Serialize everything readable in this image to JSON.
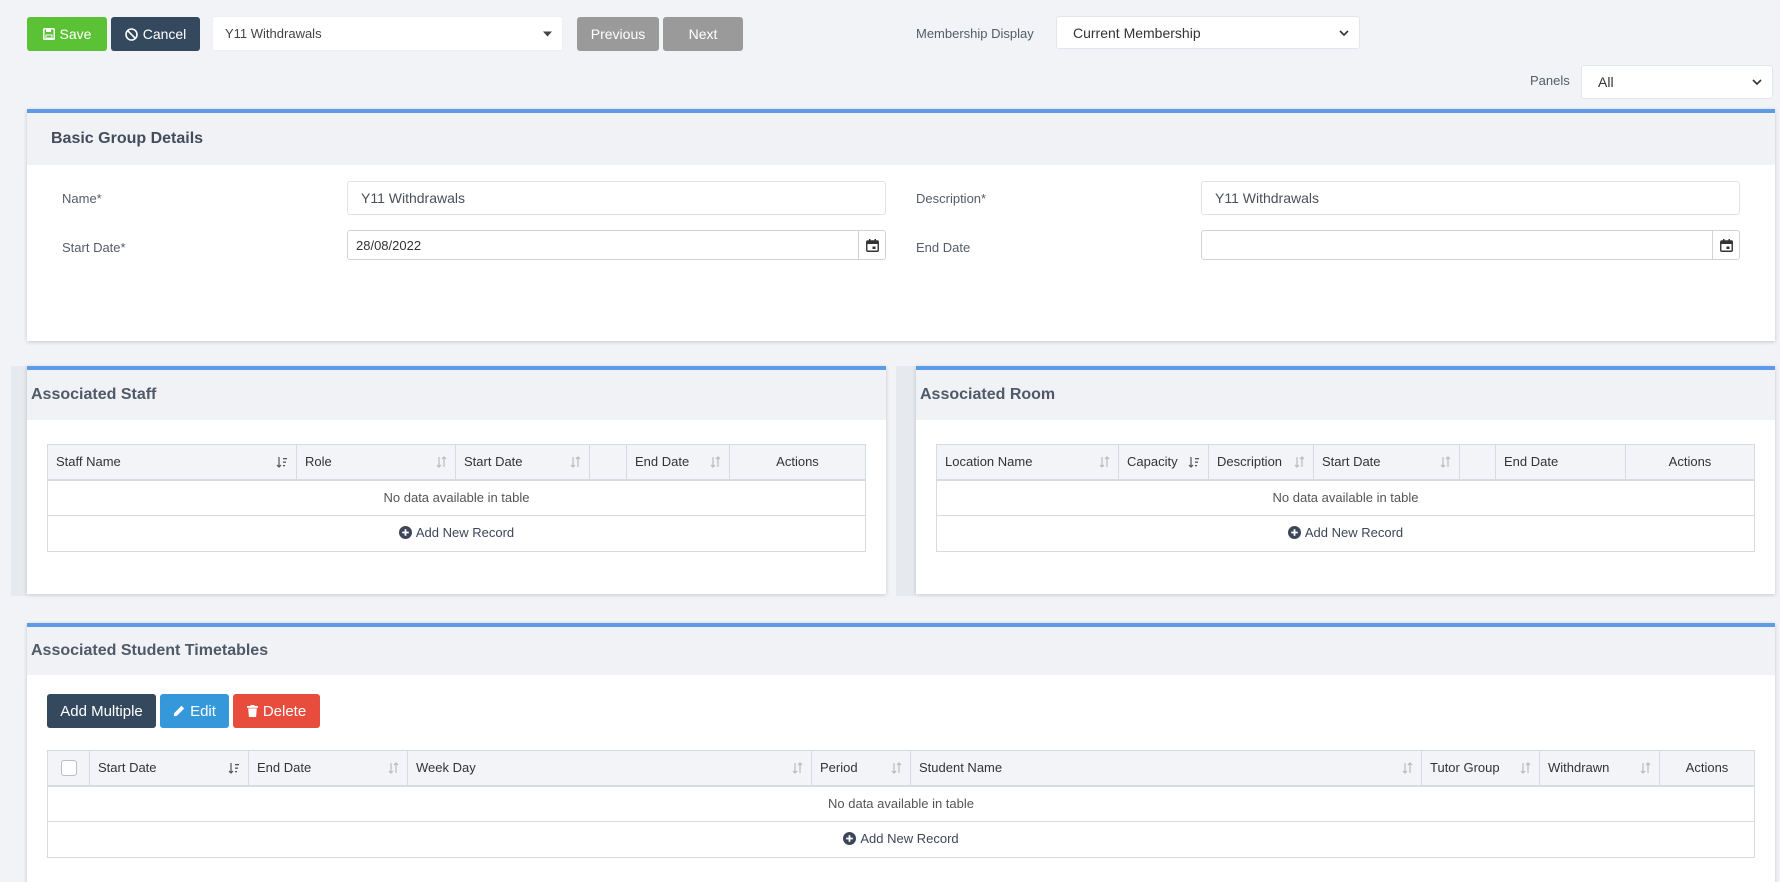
{
  "toolbar": {
    "save_label": "Save",
    "cancel_label": "Cancel",
    "group_select_value": "Y11 Withdrawals",
    "previous_label": "Previous",
    "next_label": "Next",
    "membership_display_label": "Membership Display",
    "membership_display_value": "Current Membership",
    "panels_label": "Panels",
    "panels_value": "All"
  },
  "basic_details": {
    "title": "Basic Group Details",
    "name_label": "Name*",
    "name_value": "Y11 Withdrawals",
    "description_label": "Description*",
    "description_value": "Y11 Withdrawals",
    "start_date_label": "Start Date*",
    "start_date_value": "28/08/2022",
    "end_date_label": "End Date",
    "end_date_value": ""
  },
  "staff": {
    "title": "Associated Staff",
    "columns": [
      "Staff Name",
      "Role",
      "Start Date",
      "",
      "End Date",
      "Actions"
    ],
    "empty_text": "No data available in table",
    "add_label": "Add New Record"
  },
  "room": {
    "title": "Associated Room",
    "columns": [
      "Location Name",
      "Capacity",
      "Description",
      "Start Date",
      "",
      "End Date",
      "Actions"
    ],
    "empty_text": "No data available in table",
    "add_label": "Add New Record"
  },
  "timetables": {
    "title": "Associated Student Timetables",
    "add_multiple_label": "Add Multiple",
    "edit_label": "Edit",
    "delete_label": "Delete",
    "columns": [
      "",
      "Start Date",
      "End Date",
      "Week Day",
      "Period",
      "Student Name",
      "Tutor Group",
      "Withdrawn",
      "Actions"
    ],
    "empty_text": "No data available in table",
    "add_label": "Add New Record"
  },
  "colors": {
    "save": "#5bc236",
    "cancel": "#34495e",
    "nav": "#9a9a9a",
    "panel_accent": "#5b9be8",
    "edit": "#3498db",
    "delete": "#e74c3c"
  },
  "icons": [
    "floppy-icon",
    "ban-icon",
    "caret-down-icon",
    "calendar-icon",
    "sort-icon",
    "sort-asc-icon",
    "plus-circle-icon",
    "pencil-icon",
    "trash-icon"
  ]
}
